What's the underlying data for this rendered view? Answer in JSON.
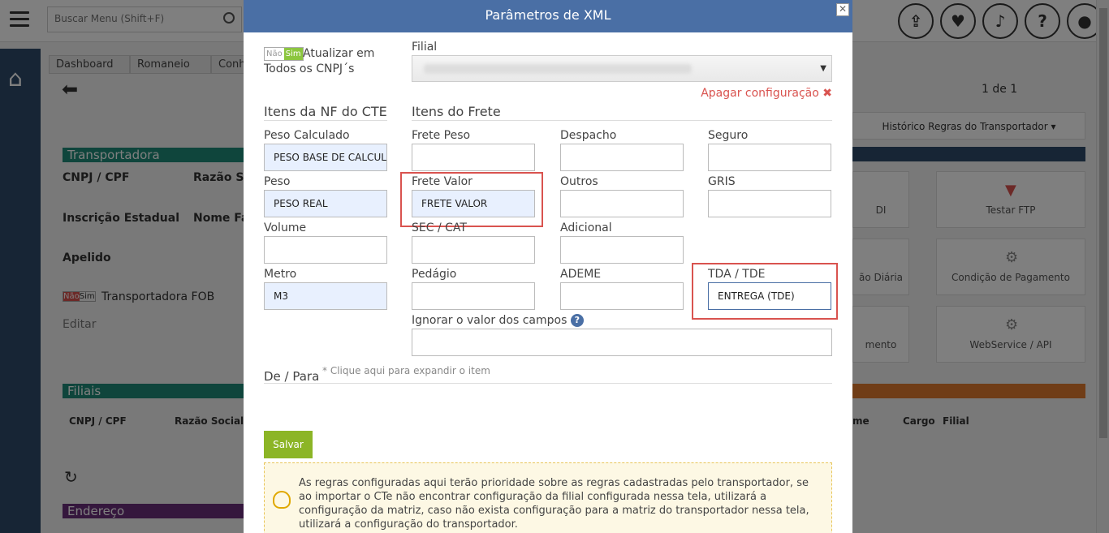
{
  "app": {
    "search_placeholder": "Buscar Menu  (Shift+F)",
    "tabs": [
      "Dashboard",
      "Romaneio",
      "Conh"
    ],
    "bg_labels": {
      "transportadora": "Transportadora",
      "cnpj": "CNPJ / CPF",
      "razao": "Razão Soc",
      "ie": "Inscrição Estadual",
      "nome": "Nome Fan",
      "apelido": "Apelido",
      "fob": "Transportadora FOB",
      "editar": "Editar",
      "filiais": "Filiais",
      "fil_cnpj": "CNPJ / CPF",
      "fil_razao": "Razão Social",
      "endereco": "Endereço",
      "pagination": "1 de 1",
      "historico": "Histórico Regras do Transportador",
      "testar_ftp": "Testar FTP",
      "cond_pag": "Condição de Pagamento",
      "webservice": "WebService / API",
      "di": "DI",
      "diaria": "ão Diária",
      "mento": "mento",
      "col_me": "me",
      "col_cargo": "Cargo",
      "col_filial": "Filial"
    },
    "toggle_no": "Não",
    "toggle_yes": "Sim"
  },
  "modal": {
    "title": "Parâmetros de XML",
    "close": "✕",
    "atualizar_label": "Atualizar em Todos os CNPJ´s",
    "filial_label": "Filial",
    "apagar": "Apagar configuração",
    "apagar_icon": "✖",
    "itens_nf": "Itens da NF do CTE",
    "itens_frete": "Itens do Frete",
    "fields": {
      "peso_calculado": {
        "label": "Peso Calculado",
        "value": "PESO BASE DE CALCULO"
      },
      "peso": {
        "label": "Peso",
        "value": "PESO REAL"
      },
      "volume": {
        "label": "Volume",
        "value": ""
      },
      "metro": {
        "label": "Metro",
        "value": "M3"
      },
      "frete_peso": {
        "label": "Frete Peso",
        "value": ""
      },
      "frete_valor": {
        "label": "Frete Valor",
        "value": "FRETE VALOR"
      },
      "sec_cat": {
        "label": "SEC / CAT",
        "value": ""
      },
      "pedagio": {
        "label": "Pedágio",
        "value": ""
      },
      "despacho": {
        "label": "Despacho",
        "value": ""
      },
      "outros": {
        "label": "Outros",
        "value": ""
      },
      "adicional": {
        "label": "Adicional",
        "value": ""
      },
      "ademe": {
        "label": "ADEME",
        "value": ""
      },
      "seguro": {
        "label": "Seguro",
        "value": ""
      },
      "gris": {
        "label": "GRIS",
        "value": ""
      },
      "tda_tde": {
        "label": "TDA / TDE",
        "value": "ENTREGA (TDE)"
      }
    },
    "ignorar_label": "Ignorar o valor dos campos",
    "help": "?",
    "de_para": "De / Para",
    "de_para_hint": "* Clique aqui para expandir o item",
    "salvar": "Salvar",
    "note": "As regras configuradas aqui terão prioridade sobre as regras cadastradas pelo transportador, se ao importar o CTe não encontrar configuração da filial configurada nessa tela, utilizará a configuração da matriz, caso não exista configuração para a matriz do transportador nessa tela, utilizará a configuração do transportador."
  },
  "colors": {
    "header": "#4a6fa5",
    "highlight": "#d9534f",
    "save": "#8cb526"
  }
}
